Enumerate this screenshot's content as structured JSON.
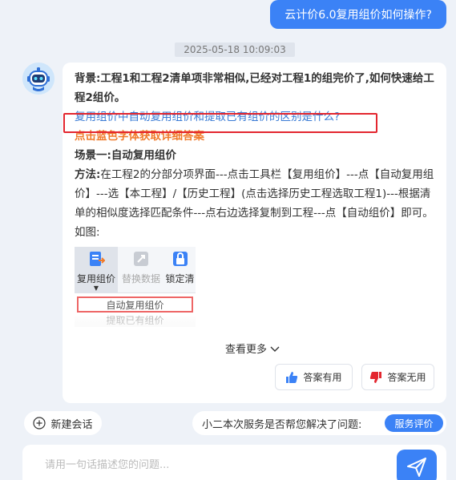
{
  "user_question": "云计价6.0复用组价如何操作?",
  "timestamp": "2025-05-18 10:09:03",
  "answer": {
    "background_label": "背景:",
    "background_text": "工程1和工程2清单项非常相似,已经对工程1的组完价了,如何快速给工程2组价。",
    "link_question": "复用组价中自动复用组价和提取已有组价的区别是什么?",
    "hint": "点击蓝色字体获取详细答案",
    "scene_title": "场景一:自动复用组价",
    "method_label": "方法:",
    "method_text": "在工程2的分部分项界面---点击工具栏【复用组价】---点【自动复用组价】---选【本工程】/【历史工程】(点击选择历史工程选取工程1)---根据清单的相似度选择匹配条件---点右边选择复制到工程---点【自动组价】即可。如图:"
  },
  "toolbar_image": {
    "btn1": "复用组价",
    "btn2": "替换数据",
    "btn3": "锁定清",
    "menu1": "自动复用组价",
    "menu2": "提取已有组价"
  },
  "see_more": "查看更多",
  "feedback": {
    "useful": "答案有用",
    "useless": "答案无用"
  },
  "new_chat": "新建会话",
  "survey": {
    "question": "小二本次服务是否帮您解决了问题:",
    "button": "服务评价"
  },
  "input": {
    "placeholder": "请用一句话描述您的问题..."
  },
  "colors": {
    "primary": "#3b82f6",
    "highlight_red": "#e3262f",
    "orange": "#f07a2a",
    "link": "#3a7bd5"
  }
}
